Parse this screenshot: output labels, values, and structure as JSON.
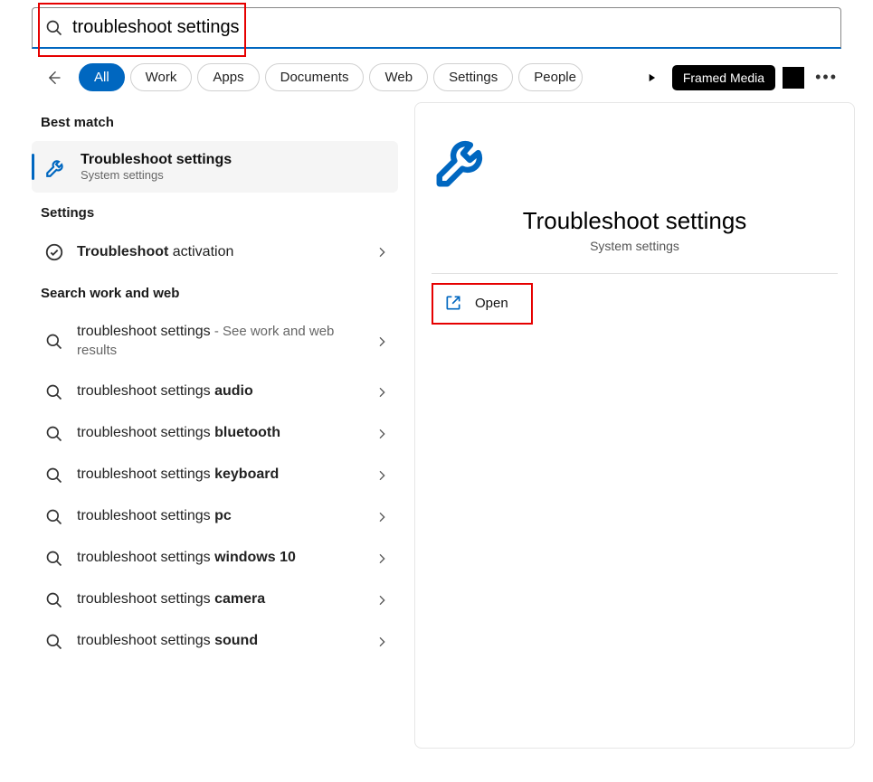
{
  "search": {
    "value": "troubleshoot settings"
  },
  "tabs": {
    "all": "All",
    "work": "Work",
    "apps": "Apps",
    "documents": "Documents",
    "web": "Web",
    "settings": "Settings",
    "people": "People"
  },
  "framed": "Framed Media",
  "left": {
    "best_match_header": "Best match",
    "best_match": {
      "title": "Troubleshoot settings",
      "subtitle": "System settings"
    },
    "settings_header": "Settings",
    "settings_item": {
      "prefix_bold": "Troubleshoot",
      "suffix": " activation"
    },
    "search_header": "Search work and web",
    "web_first": {
      "primary": "troubleshoot settings",
      "secondary": " - See work and web results"
    },
    "web_items": [
      {
        "prefix": "troubleshoot settings ",
        "bold": "audio"
      },
      {
        "prefix": "troubleshoot settings ",
        "bold": "bluetooth"
      },
      {
        "prefix": "troubleshoot settings ",
        "bold": "keyboard"
      },
      {
        "prefix": "troubleshoot settings ",
        "bold": "pc"
      },
      {
        "prefix": "troubleshoot settings ",
        "bold": "windows 10"
      },
      {
        "prefix": "troubleshoot settings ",
        "bold": "camera"
      },
      {
        "prefix": "troubleshoot settings ",
        "bold": "sound"
      }
    ]
  },
  "right": {
    "title": "Troubleshoot settings",
    "subtitle": "System settings",
    "open": "Open"
  }
}
